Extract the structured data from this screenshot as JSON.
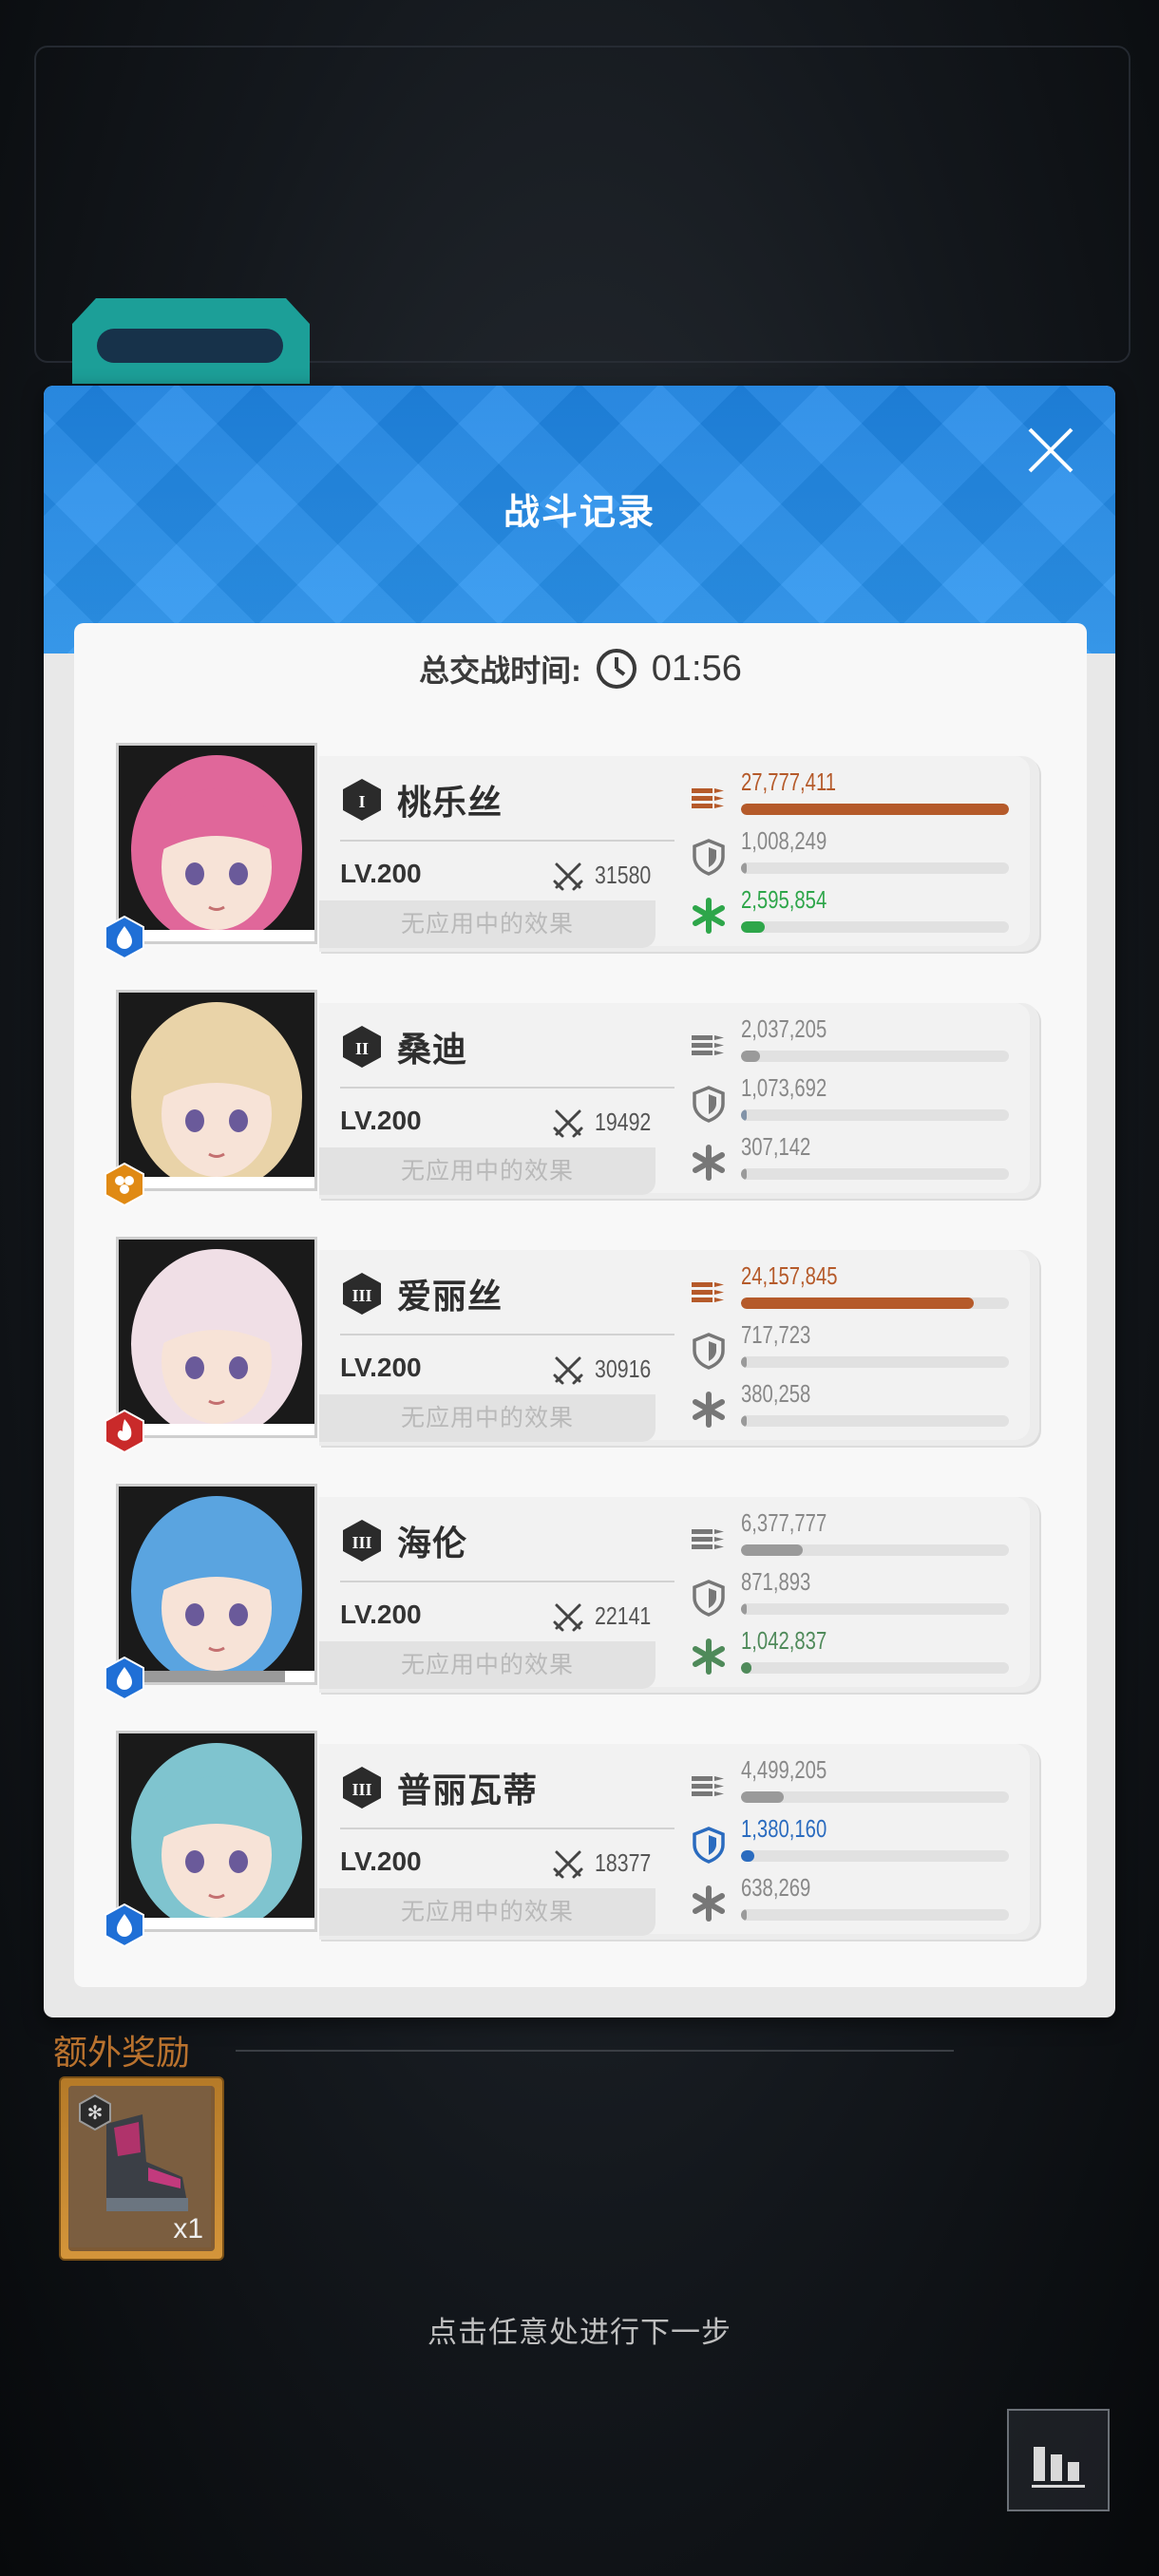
{
  "dialog": {
    "title": "战斗记录",
    "timer_label": "总交战时间:",
    "timer_value": "01:56"
  },
  "characters": [
    {
      "rank": "I",
      "name": "桃乐丝",
      "level": "LV.200",
      "power": "31580",
      "effects": "无应用中的效果",
      "element": "water",
      "element_color": "#1f6fd6",
      "hair_color": "#e0679a",
      "hp_fraction": 0.0,
      "stats": [
        {
          "type": "damage",
          "value": "27,777,411",
          "fraction": 1.0,
          "highlight": true,
          "color": "#b55a2a"
        },
        {
          "type": "defense",
          "value": "1,008,249",
          "fraction": 0.02,
          "highlight": false,
          "color": "#9a9a9a"
        },
        {
          "type": "heal",
          "value": "2,595,854",
          "fraction": 0.09,
          "highlight": true,
          "color": "#2ea64a"
        }
      ]
    },
    {
      "rank": "II",
      "name": "桑迪",
      "level": "LV.200",
      "power": "19492",
      "effects": "无应用中的效果",
      "element": "electric",
      "element_color": "#e08a14",
      "hair_color": "#e9d3a8",
      "hp_fraction": 0.0,
      "stats": [
        {
          "type": "damage",
          "value": "2,037,205",
          "fraction": 0.07,
          "highlight": false,
          "color": "#9a9a9a"
        },
        {
          "type": "defense",
          "value": "1,073,692",
          "fraction": 0.02,
          "highlight": false,
          "color": "#8293a8"
        },
        {
          "type": "heal",
          "value": "307,142",
          "fraction": 0.01,
          "highlight": false,
          "color": "#9a9a9a"
        }
      ]
    },
    {
      "rank": "III",
      "name": "爱丽丝",
      "level": "LV.200",
      "power": "30916",
      "effects": "无应用中的效果",
      "element": "fire",
      "element_color": "#c92a2a",
      "hair_color": "#f0dfe6",
      "hp_fraction": 0.0,
      "stats": [
        {
          "type": "damage",
          "value": "24,157,845",
          "fraction": 0.87,
          "highlight": true,
          "color": "#b55a2a"
        },
        {
          "type": "defense",
          "value": "717,723",
          "fraction": 0.01,
          "highlight": false,
          "color": "#9a9a9a"
        },
        {
          "type": "heal",
          "value": "380,258",
          "fraction": 0.01,
          "highlight": false,
          "color": "#9a9a9a"
        }
      ]
    },
    {
      "rank": "III",
      "name": "海伦",
      "level": "LV.200",
      "power": "22141",
      "effects": "无应用中的效果",
      "element": "water",
      "element_color": "#1f6fd6",
      "hair_color": "#5aa4e0",
      "hp_fraction": 0.85,
      "stats": [
        {
          "type": "damage",
          "value": "6,377,777",
          "fraction": 0.23,
          "highlight": false,
          "color": "#9a9a9a"
        },
        {
          "type": "defense",
          "value": "871,893",
          "fraction": 0.02,
          "highlight": false,
          "color": "#9a9a9a"
        },
        {
          "type": "heal",
          "value": "1,042,837",
          "fraction": 0.04,
          "highlight": true,
          "color": "#4f8a5a"
        }
      ]
    },
    {
      "rank": "III",
      "name": "普丽瓦蒂",
      "level": "LV.200",
      "power": "18377",
      "effects": "无应用中的效果",
      "element": "water",
      "element_color": "#1f6fd6",
      "hair_color": "#7fc4cf",
      "hp_fraction": 0.0,
      "stats": [
        {
          "type": "damage",
          "value": "4,499,205",
          "fraction": 0.16,
          "highlight": false,
          "color": "#9a9a9a"
        },
        {
          "type": "defense",
          "value": "1,380,160",
          "fraction": 0.05,
          "highlight": true,
          "color": "#2a6bbf"
        },
        {
          "type": "heal",
          "value": "638,269",
          "fraction": 0.02,
          "highlight": false,
          "color": "#9a9a9a"
        }
      ]
    }
  ],
  "bonus": {
    "label": "额外奖励",
    "item_icon": "boots-icon",
    "quantity": "x1"
  },
  "hint": "点击任意处进行下一步",
  "icons": {
    "close": "close-icon",
    "clock": "clock-icon",
    "damage": "ammo-icon",
    "defense": "shield-icon",
    "heal": "heal-icon",
    "power": "crossed-swords-icon",
    "stats_button": "bar-chart-icon"
  }
}
